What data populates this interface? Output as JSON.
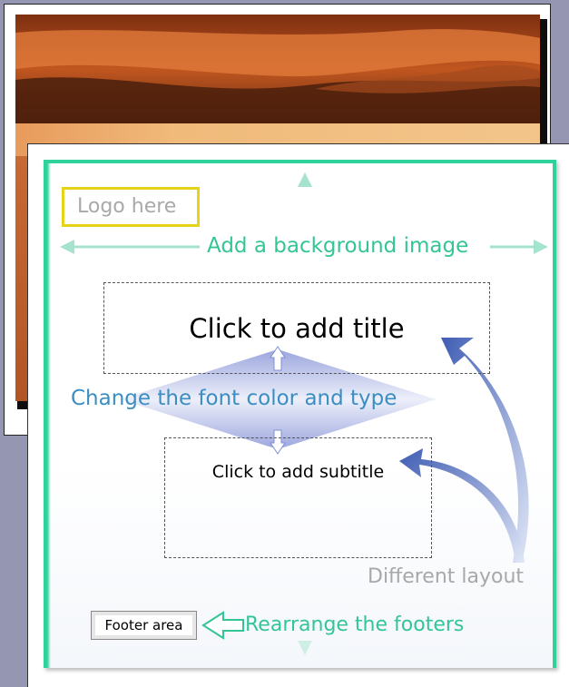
{
  "slide": {
    "logo": "Logo here",
    "background_hint": "Add a background image",
    "title_placeholder": "Click to add title",
    "font_hint": "Change the font color and type",
    "subtitle_placeholder": "Click to add subtitle",
    "layout_hint": "Different layout",
    "footer_placeholder": "Footer area",
    "footer_hint": "Rearrange the footers"
  },
  "colors": {
    "guide_green": "#34c596",
    "frame_green": "#2fd29a",
    "logo_yellow": "#e7d21a",
    "font_blue": "#3b8ec1",
    "arrow_blue": "#4a68b8",
    "page_bg": "#9597b2"
  },
  "icons": [
    "double-arrow-horizontal-icon",
    "double-arrow-vertical-icon",
    "curved-arrow-icon",
    "hollow-left-arrow-icon",
    "up-arrow-icon",
    "down-arrow-icon"
  ]
}
